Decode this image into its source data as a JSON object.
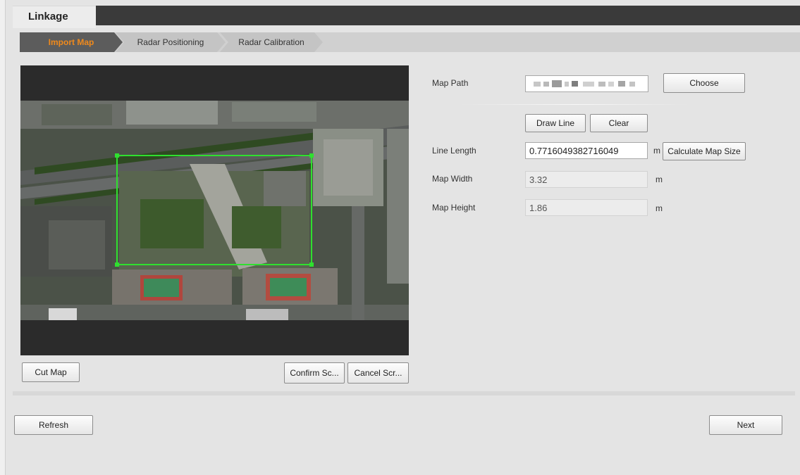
{
  "header": {
    "tab_label": "Linkage"
  },
  "steps": [
    {
      "label": "Import Map",
      "active": true
    },
    {
      "label": "Radar Positioning",
      "active": false
    },
    {
      "label": "Radar Calibration",
      "active": false
    }
  ],
  "map_area": {
    "cut_map_label": "Cut Map",
    "confirm_label": "Confirm Sc...",
    "cancel_label": "Cancel Scr..."
  },
  "form": {
    "map_path": {
      "label": "Map Path",
      "choose_label": "Choose"
    },
    "draw_line_label": "Draw Line",
    "clear_label": "Clear",
    "line_length": {
      "label": "Line Length",
      "value": "0.7716049382716049",
      "unit": "m",
      "calc_label": "Calculate Map Size"
    },
    "map_width": {
      "label": "Map Width",
      "value": "3.32",
      "unit": "m"
    },
    "map_height": {
      "label": "Map Height",
      "value": "1.86",
      "unit": "m"
    }
  },
  "footer": {
    "refresh_label": "Refresh",
    "next_label": "Next"
  },
  "colors": {
    "active_step": "#f08a1c",
    "selection_box": "#2fe02f"
  }
}
